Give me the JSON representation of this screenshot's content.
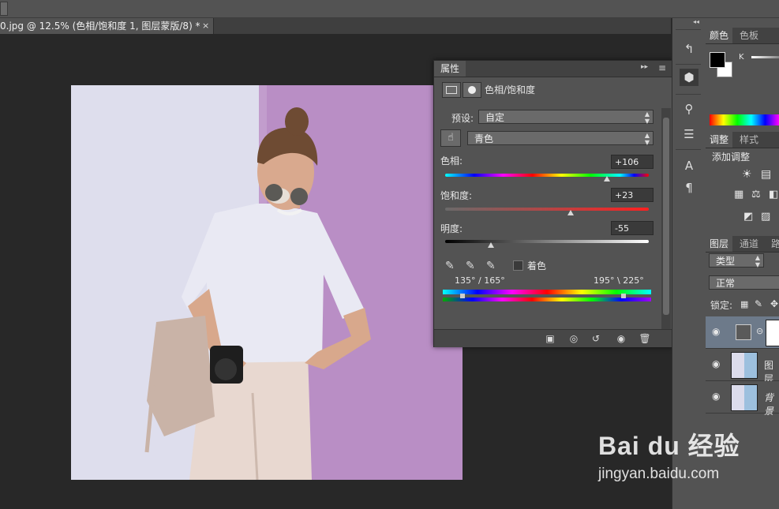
{
  "document": {
    "tab_title": "0.jpg @ 12.5% (色相/饱和度 1, 图层蒙版/8) *",
    "close_glyph": "×"
  },
  "properties_panel": {
    "tab_label": "属性",
    "adjustment_title": "色相/饱和度",
    "preset_label": "预设:",
    "preset_value": "自定",
    "channel_value": "青色",
    "hue_label": "色相:",
    "hue_value": "+106",
    "hue_level": 106,
    "saturation_label": "饱和度:",
    "saturation_value": "+23",
    "saturation_level": 23,
    "lightness_label": "明度:",
    "lightness_value": "-55",
    "lightness_level": -55,
    "colorize_label": "着色",
    "colorize_checked": false,
    "range_left": "135° / 165°",
    "range_right": "195° \\ 225°"
  },
  "color_panel": {
    "tab_color": "颜色",
    "tab_swatches": "色板",
    "channel_label": "K"
  },
  "adjust_panel": {
    "tab_adjust": "调整",
    "tab_styles": "样式",
    "add_label": "添加调整"
  },
  "layers_panel": {
    "tab_layers": "图层",
    "tab_channels": "通道",
    "tab_paths": "路",
    "kind_filter": "类型",
    "blend_mode": "正常",
    "lock_label": "锁定:",
    "layers": [
      {
        "name": "",
        "type": "adjustment"
      },
      {
        "name": "图层",
        "type": "photo"
      },
      {
        "name": "背景",
        "type": "photo"
      }
    ]
  },
  "watermark": {
    "brand": "Bai du 经验",
    "url": "jingyan.baidu.com"
  },
  "colors": {
    "ui_panel": "#535353",
    "ui_dark": "#424242",
    "canvas_bg": "#282828",
    "wall_left": "#dcdcec",
    "wall_right": "#b88ec4"
  }
}
